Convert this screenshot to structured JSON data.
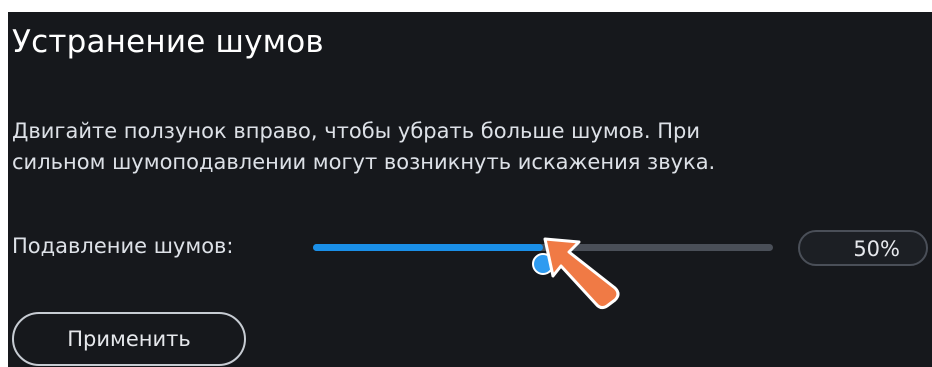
{
  "panel": {
    "title": "Устранение шумов",
    "description_lines": [
      "Двигайте ползунок вправо, чтобы убрать больше шумов. При",
      "сильном шумоподавлении могут возникнуть искажения звука."
    ]
  },
  "noise_suppression": {
    "label": "Подавление шумов:",
    "value_percent": 50,
    "value_text": "50%"
  },
  "apply_button": {
    "label": "Применить"
  },
  "colors": {
    "background": "#16181c",
    "accent": "#1a8fe8",
    "track": "#4a4f58",
    "pointer": "#f07a45"
  },
  "icons": {
    "cursor": "hand-pointer-arrow-icon"
  }
}
